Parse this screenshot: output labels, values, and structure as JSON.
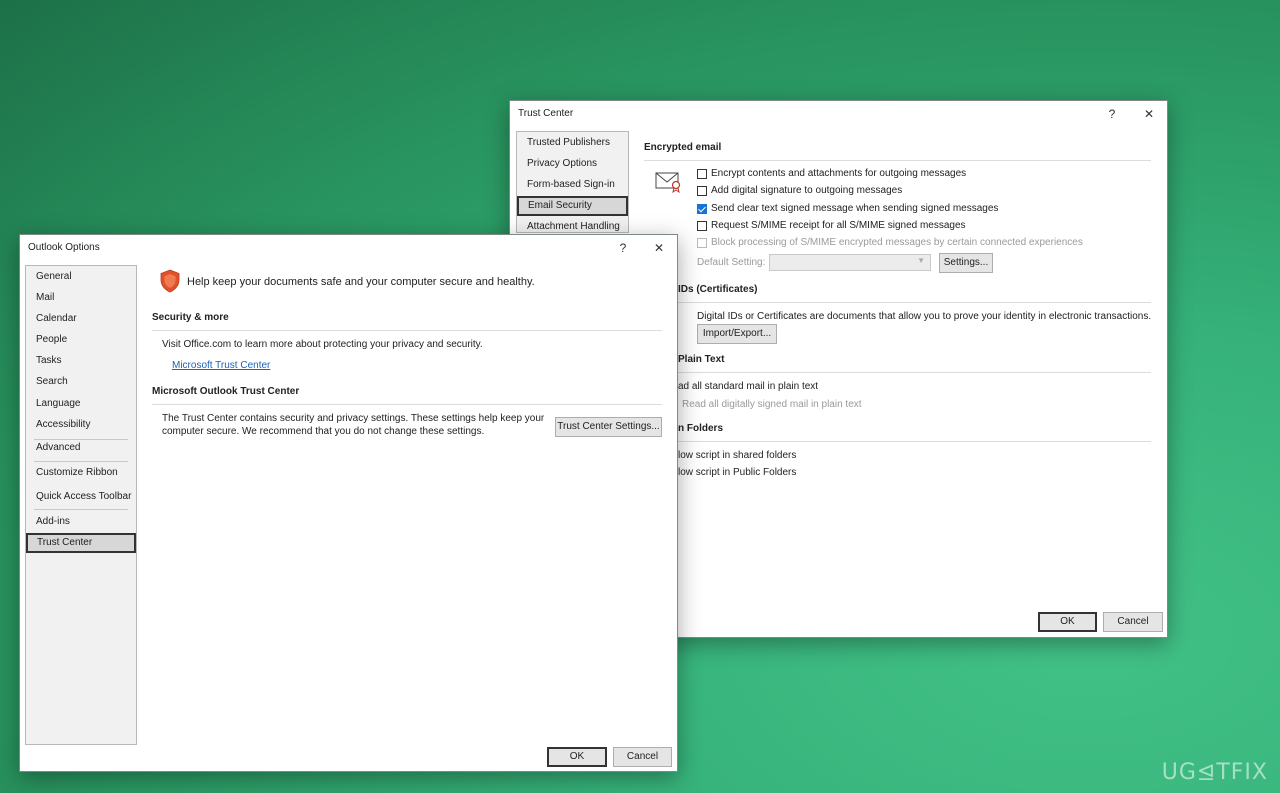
{
  "trust_center": {
    "title": "Trust Center",
    "help_glyph": "?",
    "close_glyph": "✕",
    "nav": [
      "Trusted Publishers",
      "Privacy Options",
      "Form-based Sign-in",
      "Email Security",
      "Attachment Handling"
    ],
    "selected_nav": "Email Security",
    "encrypted_email": {
      "heading": "Encrypted email",
      "options": [
        {
          "label": "Encrypt contents and attachments for outgoing messages",
          "checked": false,
          "disabled": false
        },
        {
          "label": "Add digital signature to outgoing messages",
          "checked": false,
          "disabled": false
        },
        {
          "label": "Send clear text signed message when sending signed messages",
          "checked": true,
          "disabled": false
        },
        {
          "label": "Request S/MIME receipt for all S/MIME signed messages",
          "checked": false,
          "disabled": false
        },
        {
          "label": "Block processing of S/MIME encrypted messages by certain connected experiences",
          "checked": false,
          "disabled": true
        }
      ],
      "default_setting_label": "Default Setting:",
      "default_setting_value": "",
      "settings_button": "Settings..."
    },
    "digital_ids": {
      "heading": "IDs (Certificates)",
      "description": "Digital IDs or Certificates are documents that allow you to prove your identity in electronic transactions.",
      "import_export_button": "Import/Export..."
    },
    "plain_text": {
      "heading": "Plain Text",
      "options": [
        "ad all standard mail in plain text",
        "Read all digitally signed mail in plain text"
      ]
    },
    "folders": {
      "heading": "n Folders",
      "options": [
        "low script in shared folders",
        "low script in Public Folders"
      ]
    },
    "ok_button": "OK",
    "cancel_button": "Cancel"
  },
  "outlook_options": {
    "title": "Outlook Options",
    "help_glyph": "?",
    "close_glyph": "✕",
    "nav_groups": [
      [
        "General",
        "Mail",
        "Calendar",
        "People",
        "Tasks",
        "Search",
        "Language",
        "Accessibility"
      ],
      [
        "Advanced"
      ],
      [
        "Customize Ribbon",
        "Quick Access Toolbar"
      ],
      [
        "Add-ins",
        "Trust Center"
      ]
    ],
    "selected_nav": "Trust Center",
    "header_text": "Help keep your documents safe and your computer secure and healthy.",
    "header_icon": "shield-icon",
    "security_section": {
      "heading": "Security & more",
      "text": "Visit Office.com to learn more about protecting your privacy and security.",
      "link": "Microsoft Trust Center"
    },
    "trust_center_section": {
      "heading": "Microsoft Outlook Trust Center",
      "text_line1": "The Trust Center contains security and privacy settings. These settings help keep your",
      "text_line2": "computer secure. We recommend that you do not change these settings.",
      "button": "Trust Center Settings..."
    },
    "ok_button": "OK",
    "cancel_button": "Cancel"
  },
  "watermark": "UG⊴TFIX",
  "colors": {
    "background": "#2fa56d",
    "selection_border": "#333333",
    "link": "#1d62b5",
    "shield": "#e2522a",
    "checkbox_checked": "#1a73d2"
  }
}
